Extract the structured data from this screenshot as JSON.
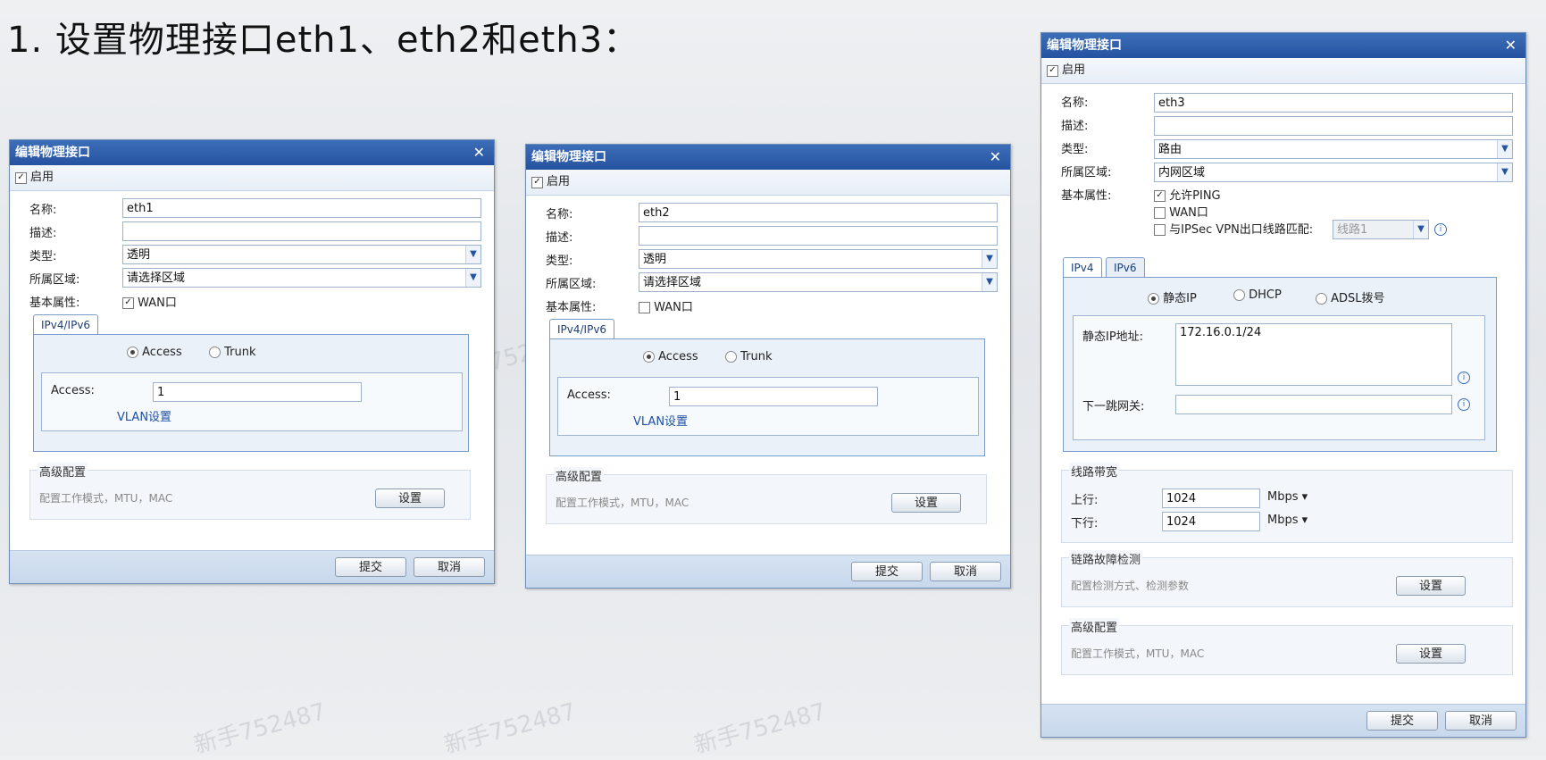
{
  "page_title": "1. 设置物理接口eth1、eth2和eth3：",
  "watermark": "新手752487",
  "colors": {
    "title_bar": "#2653a0",
    "dialog_bg": "#dfe9f5",
    "link": "#1f4fa3"
  },
  "common": {
    "dialog_title": "编辑物理接口",
    "close_glyph": "✕",
    "enable_label": "启用",
    "name_label": "名称:",
    "desc_label": "描述:",
    "type_label": "类型:",
    "zone_label": "所属区域:",
    "attr_label": "基本属性:",
    "wan_label": "WAN口",
    "submit": "提交",
    "cancel": "取消",
    "settings": "设置",
    "advanced_title": "高级配置",
    "advanced_hint": "配置工作模式，MTU，MAC"
  },
  "eth1": {
    "name": "eth1",
    "desc": "",
    "type": "透明",
    "zone": "请选择区域",
    "wan_checked": true,
    "tab": "IPv4/IPv6",
    "mode_access": "Access",
    "mode_trunk": "Trunk",
    "mode_selected": "Access",
    "access_label": "Access:",
    "access_value": "1",
    "vlan_link": "VLAN设置"
  },
  "eth2": {
    "name": "eth2",
    "desc": "",
    "type": "透明",
    "zone": "请选择区域",
    "wan_checked": false,
    "tab": "IPv4/IPv6",
    "mode_access": "Access",
    "mode_trunk": "Trunk",
    "mode_selected": "Access",
    "access_label": "Access:",
    "access_value": "1",
    "vlan_link": "VLAN设置"
  },
  "eth3": {
    "name": "eth3",
    "desc": "",
    "type": "路由",
    "zone": "内网区域",
    "ping_label": "允许PING",
    "ping_checked": true,
    "wan_checked": false,
    "ipsec_label": "与IPSec VPN出口线路匹配:",
    "ipsec_checked": false,
    "ipsec_line": "线路1",
    "tab_ipv4": "IPv4",
    "tab_ipv6": "IPv6",
    "ip_static": "静态IP",
    "ip_dhcp": "DHCP",
    "ip_adsl": "ADSL拨号",
    "static_ip_label": "静态IP地址:",
    "static_ip_value": "172.16.0.1/24",
    "gateway_label": "下一跳网关:",
    "gateway_value": "",
    "bandwidth_title": "线路带宽",
    "up_label": "上行:",
    "up_value": "1024",
    "down_label": "下行:",
    "down_value": "1024",
    "unit": "Mbps ▾",
    "fault_title": "链路故障检测",
    "fault_hint": "配置检测方式、检测参数"
  }
}
